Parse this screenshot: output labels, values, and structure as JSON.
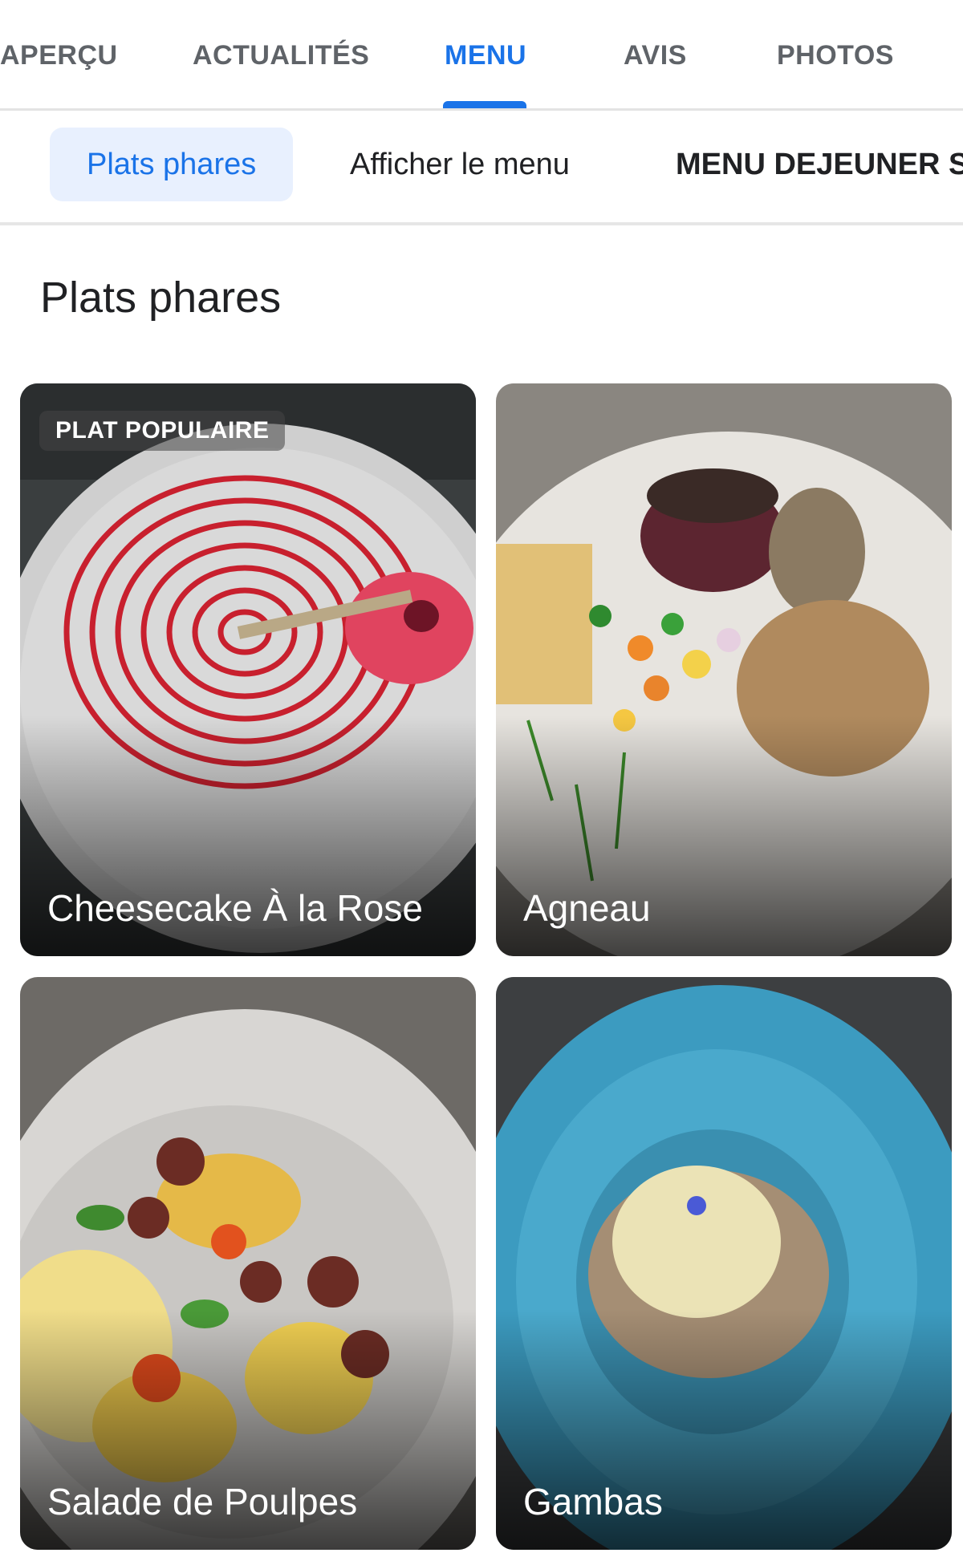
{
  "tabs": [
    {
      "label": "APERÇU"
    },
    {
      "label": "ACTUALITÉS"
    },
    {
      "label": "MENU"
    },
    {
      "label": "AVIS"
    },
    {
      "label": "PHOTOS"
    }
  ],
  "active_tab": "MENU",
  "chips": [
    {
      "label": "Plats phares"
    },
    {
      "label": "Afficher le menu"
    },
    {
      "label": "MENU DEJEUNER S"
    }
  ],
  "section_title": "Plats phares",
  "dishes": [
    {
      "name": "Cheesecake À la Rose",
      "badge": "PLAT POPULAIRE"
    },
    {
      "name": "Agneau"
    },
    {
      "name": "Salade de Poulpes"
    },
    {
      "name": "Gambas"
    }
  ],
  "colors": {
    "accent": "#1a73e8",
    "chip_active_bg": "#e8f0fe"
  }
}
